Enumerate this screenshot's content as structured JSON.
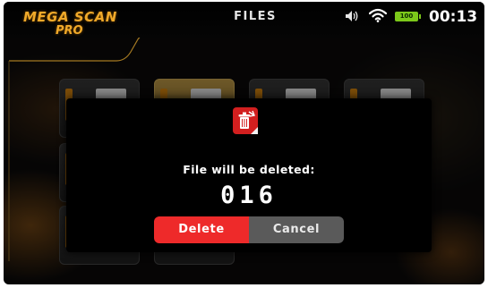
{
  "header": {
    "logo_line1": "MEGA SCAN",
    "logo_line2": "PRO",
    "title": "FILES"
  },
  "status_bar": {
    "icons": [
      "speaker-icon",
      "wifi-icon",
      "battery-icon"
    ],
    "battery_level": "100",
    "time": "00:13"
  },
  "dialog": {
    "icon": "trash-delete-icon",
    "message": "File will be deleted:",
    "file_name": "016",
    "delete_label": "Delete",
    "cancel_label": "Cancel"
  },
  "colors": {
    "accent_gold": "#f0a92a",
    "delete_red": "#ee2a2a",
    "cancel_gray": "#5a5a5a",
    "battery_green": "#7cc81a"
  }
}
